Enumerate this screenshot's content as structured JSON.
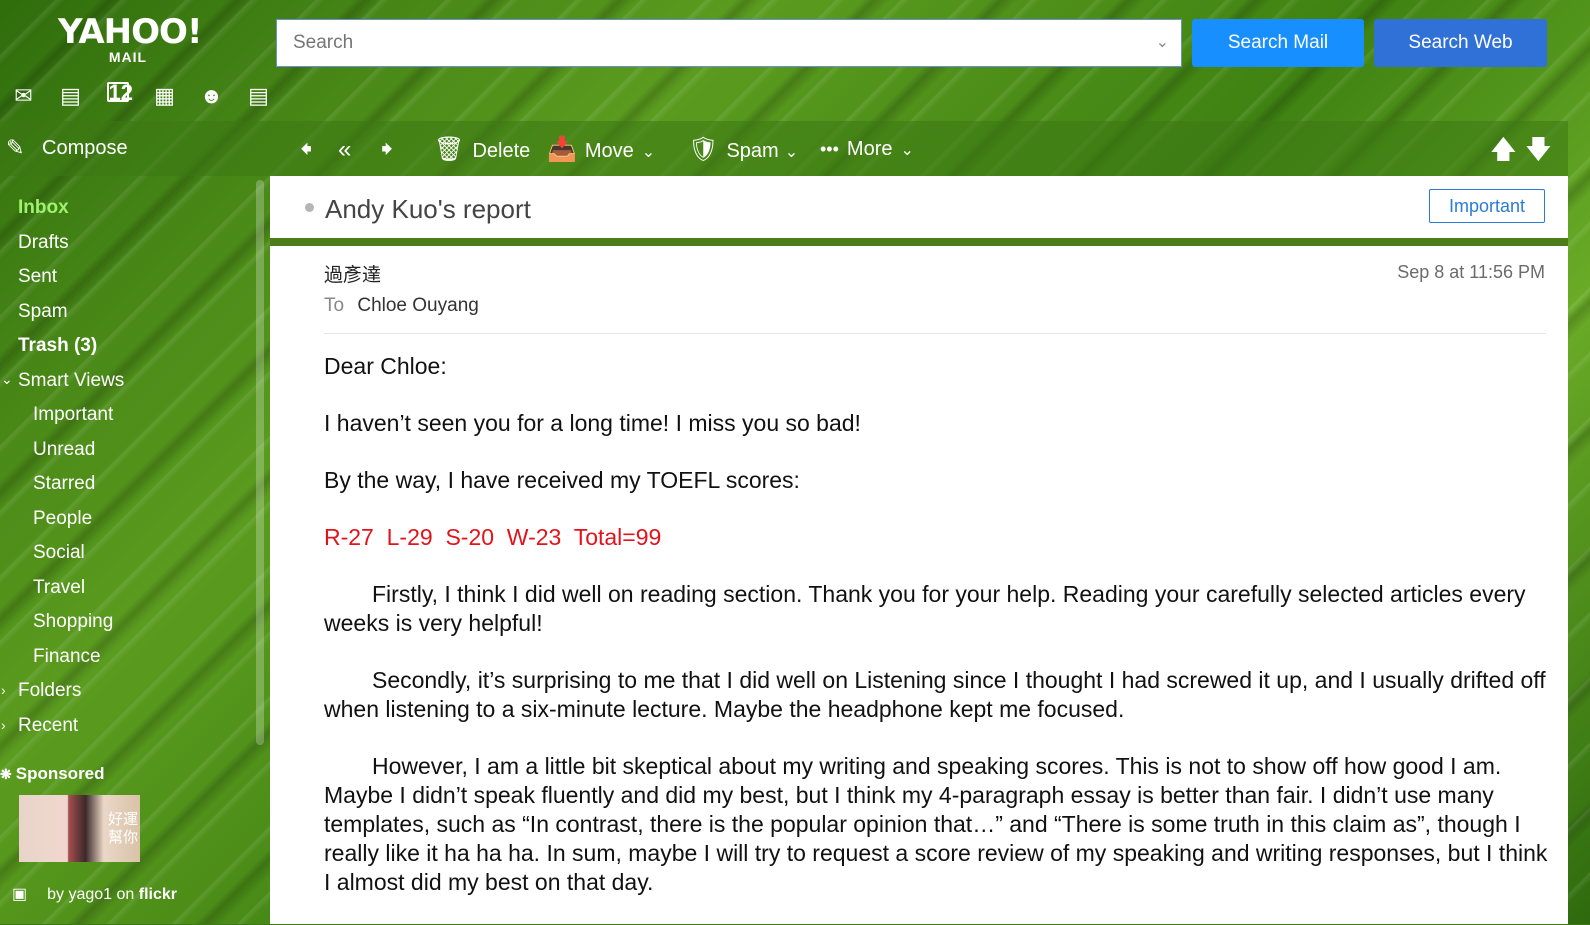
{
  "header": {
    "logo_main": "YAHOO!",
    "logo_sub": "MAIL",
    "search_placeholder": "Search",
    "search_mail_label": "Search Mail",
    "search_web_label": "Search Web",
    "app_icons": [
      "mail-icon",
      "contacts-icon",
      "calendar-icon",
      "notepad-icon",
      "messenger-icon",
      "newsfeed-icon"
    ],
    "calendar_day": "12"
  },
  "toolbar": {
    "compose_label": "Compose",
    "delete_label": "Delete",
    "move_label": "Move",
    "spam_label": "Spam",
    "more_label": "More"
  },
  "sidebar": {
    "items": [
      {
        "label": "Inbox"
      },
      {
        "label": "Drafts"
      },
      {
        "label": "Sent"
      },
      {
        "label": "Spam"
      },
      {
        "label": "Trash (3)"
      },
      {
        "label": "Smart Views"
      },
      {
        "label": "Important"
      },
      {
        "label": "Unread"
      },
      {
        "label": "Starred"
      },
      {
        "label": "People"
      },
      {
        "label": "Social"
      },
      {
        "label": "Travel"
      },
      {
        "label": "Shopping"
      },
      {
        "label": "Finance"
      },
      {
        "label": "Folders"
      },
      {
        "label": "Recent"
      }
    ],
    "sponsored_label": "Sponsored",
    "ad_text": "好運\n幫你",
    "credit_by": "by yago1 on",
    "credit_site": "flickr"
  },
  "message": {
    "subject": "Andy Kuo's report",
    "important_label": "Important",
    "from": "過彥達",
    "date": "Sep 8 at 11:56 PM",
    "to_label": "To",
    "to_name": "Chloe Ouyang",
    "greeting": "Dear Chloe:",
    "line1": "I haven’t seen you for a long time! I miss you so bad!",
    "line2": "By the way, I have received my TOEFL scores:",
    "scores": "R-27  L-29  S-20  W-23  Total=99",
    "para1": "Firstly, I think I did well on reading section. Thank you for your help. Reading your carefully selected articles every weeks is very helpful!",
    "para2": "Secondly, it’s surprising to me that I did well on Listening since I thought I had screwed it up, and I usually drifted off when listening to a six-minute lecture. Maybe the headphone kept me focused.",
    "para3": "However, I am a little bit skeptical about my writing and speaking scores. This is not to show off how good I am. Maybe I didn’t speak fluently and did my best, but I think my 4-paragraph essay is better than fair. I didn’t use many templates, such as “In contrast, there is the popular opinion that…” and “There is some truth in this claim as”, though I really like it ha ha ha. In sum, maybe I will try to request a score review of my speaking and writing responses, but I think I almost did my best on that day."
  }
}
